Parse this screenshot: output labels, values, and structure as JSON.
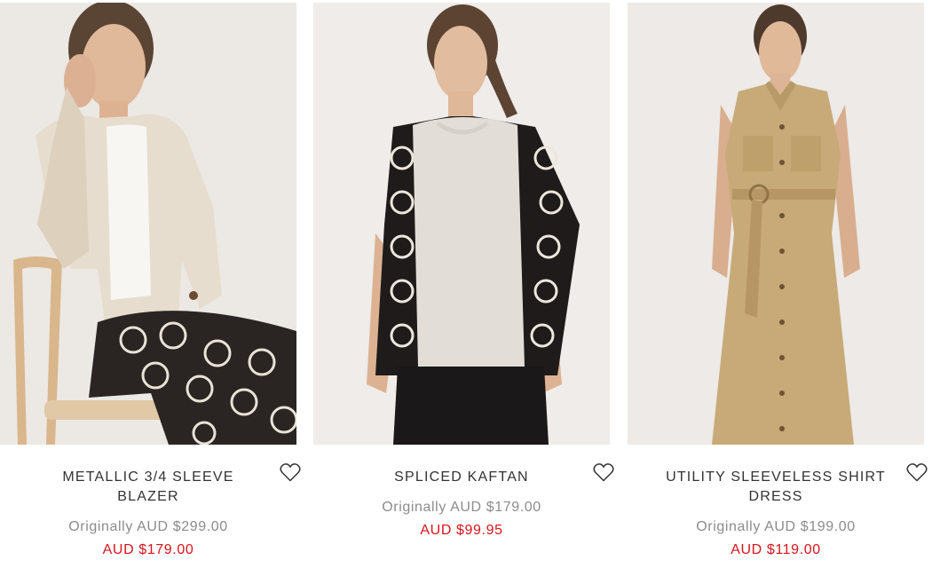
{
  "products": [
    {
      "name": "METALLIC 3/4 SLEEVE BLAZER",
      "original_price": "Originally AUD $299.00",
      "sale_price": "AUD $179.00",
      "wishlist_icon": "heart-outline-icon"
    },
    {
      "name": "SPLICED KAFTAN",
      "original_price": "Originally AUD $179.00",
      "sale_price": "AUD $99.95",
      "wishlist_icon": "heart-outline-icon"
    },
    {
      "name": "UTILITY SLEEVELESS SHIRT DRESS",
      "original_price": "Originally AUD $199.00",
      "sale_price": "AUD $119.00",
      "wishlist_icon": "heart-outline-icon"
    }
  ],
  "colors": {
    "sale_price": "#d8141b",
    "original_price": "#8c8c8c",
    "product_name": "#333333"
  }
}
